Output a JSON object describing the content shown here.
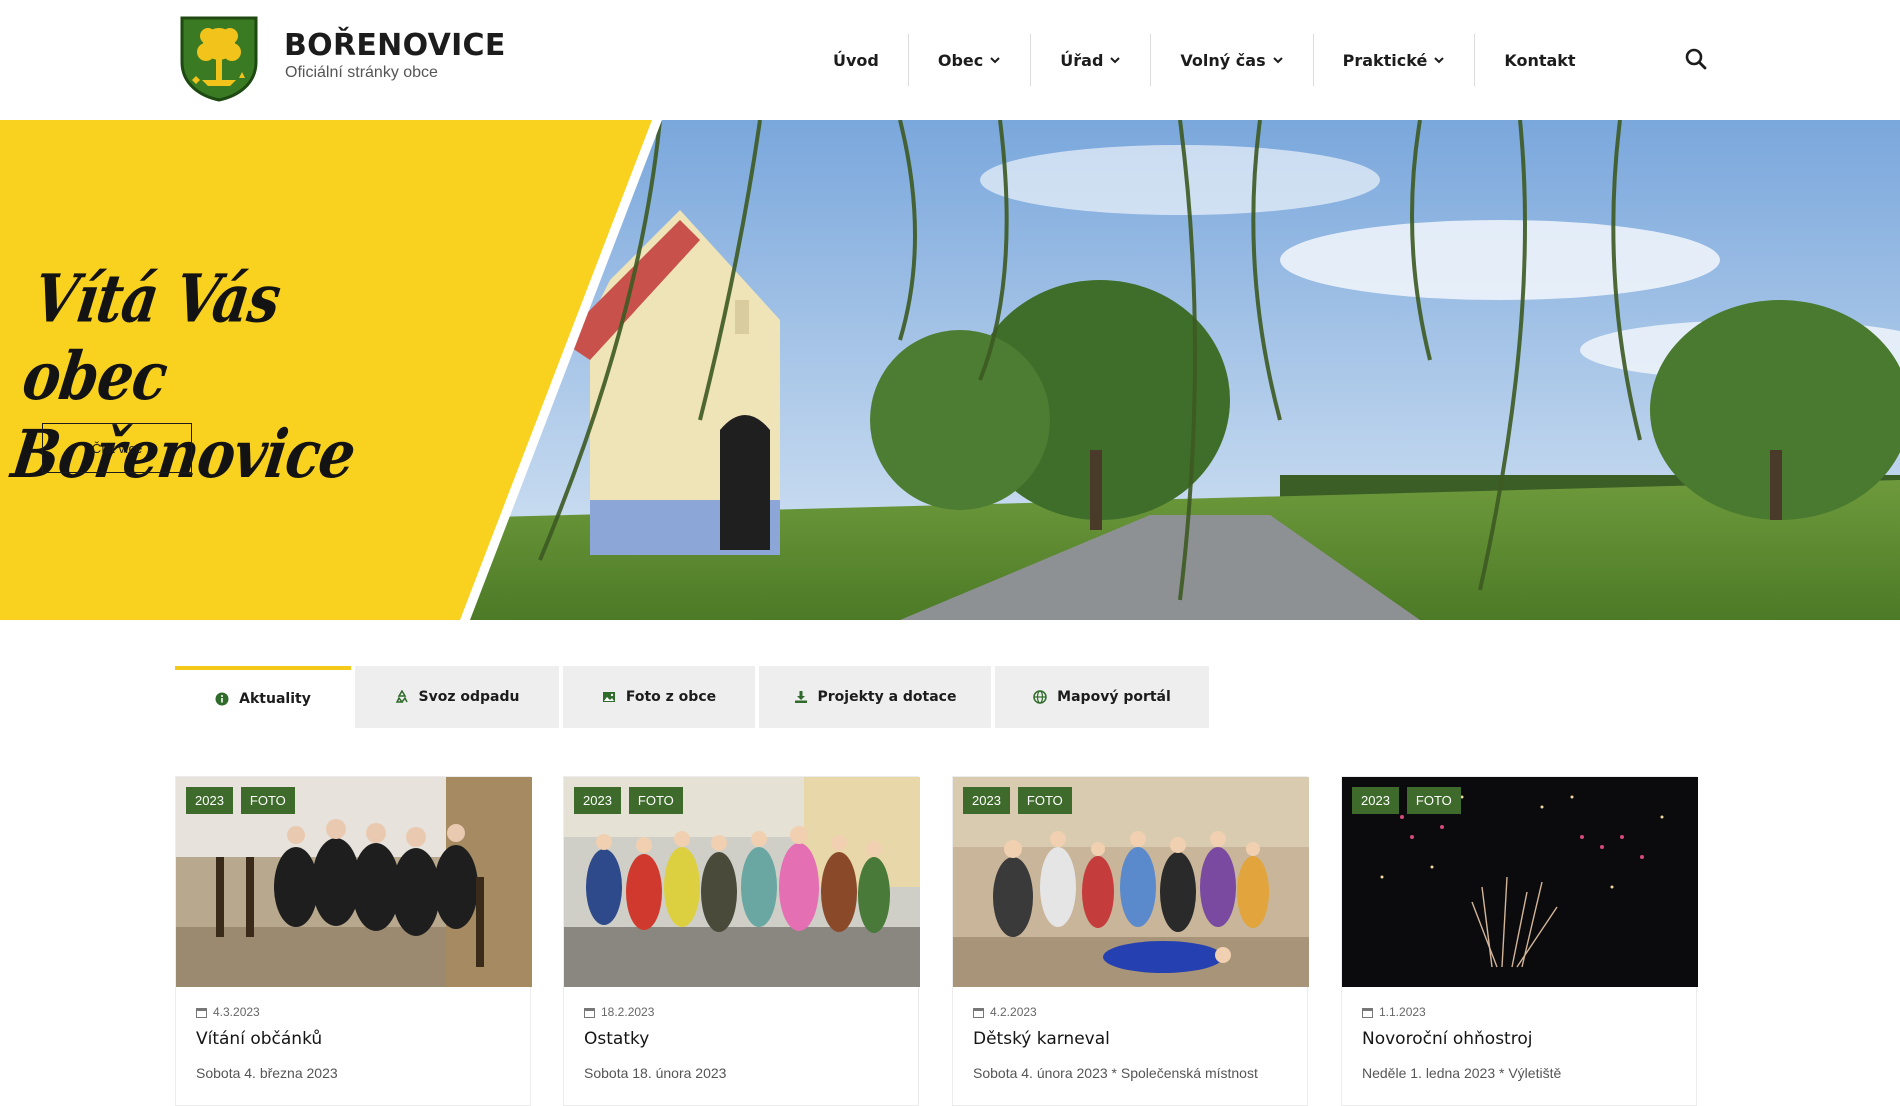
{
  "brand": {
    "title": "BOŘENOVICE",
    "subtitle": "Oficiální stránky obce",
    "logo_icon": "coat-of-arms-icon",
    "colors": {
      "shield_green": "#3a7a22",
      "shield_yellow": "#f2c31a"
    }
  },
  "nav": {
    "items": [
      {
        "label": "Úvod",
        "has_dropdown": false
      },
      {
        "label": "Obec",
        "has_dropdown": true
      },
      {
        "label": "Úřad",
        "has_dropdown": true
      },
      {
        "label": "Volný čas",
        "has_dropdown": true
      },
      {
        "label": "Praktické",
        "has_dropdown": true
      },
      {
        "label": "Kontakt",
        "has_dropdown": false
      }
    ],
    "search_icon": "search-icon"
  },
  "hero": {
    "title": "Vítá Vás obec Bořenovice",
    "button_label": "Číst více",
    "accent_color": "#f9d11f"
  },
  "tabs": [
    {
      "label": "Aktuality",
      "icon": "info-icon",
      "active": true
    },
    {
      "label": "Svoz odpadu",
      "icon": "recycle-icon",
      "active": false
    },
    {
      "label": "Foto z obce",
      "icon": "image-icon",
      "active": false
    },
    {
      "label": "Projekty a dotace",
      "icon": "download-icon",
      "active": false
    },
    {
      "label": "Mapový portál",
      "icon": "globe-icon",
      "active": false
    }
  ],
  "cards": [
    {
      "year": "2023",
      "tag": "FOTO",
      "date": "4.3.2023",
      "title": "Vítání občánků",
      "desc": "Sobota 4. března 2023"
    },
    {
      "year": "2023",
      "tag": "FOTO",
      "date": "18.2.2023",
      "title": "Ostatky",
      "desc": "Sobota 18. února 2023"
    },
    {
      "year": "2023",
      "tag": "FOTO",
      "date": "4.2.2023",
      "title": "Dětský karneval",
      "desc": "Sobota 4. února 2023 * Společenská místnost"
    },
    {
      "year": "2023",
      "tag": "FOTO",
      "date": "1.1.2023",
      "title": "Novoroční ohňostroj",
      "desc": "Neděle 1. ledna 2023 * Výletiště"
    }
  ],
  "colors": {
    "badge_green": "#3e6b2b",
    "tab_active_border": "#f5c919",
    "tab_bg": "#eeeeee"
  }
}
